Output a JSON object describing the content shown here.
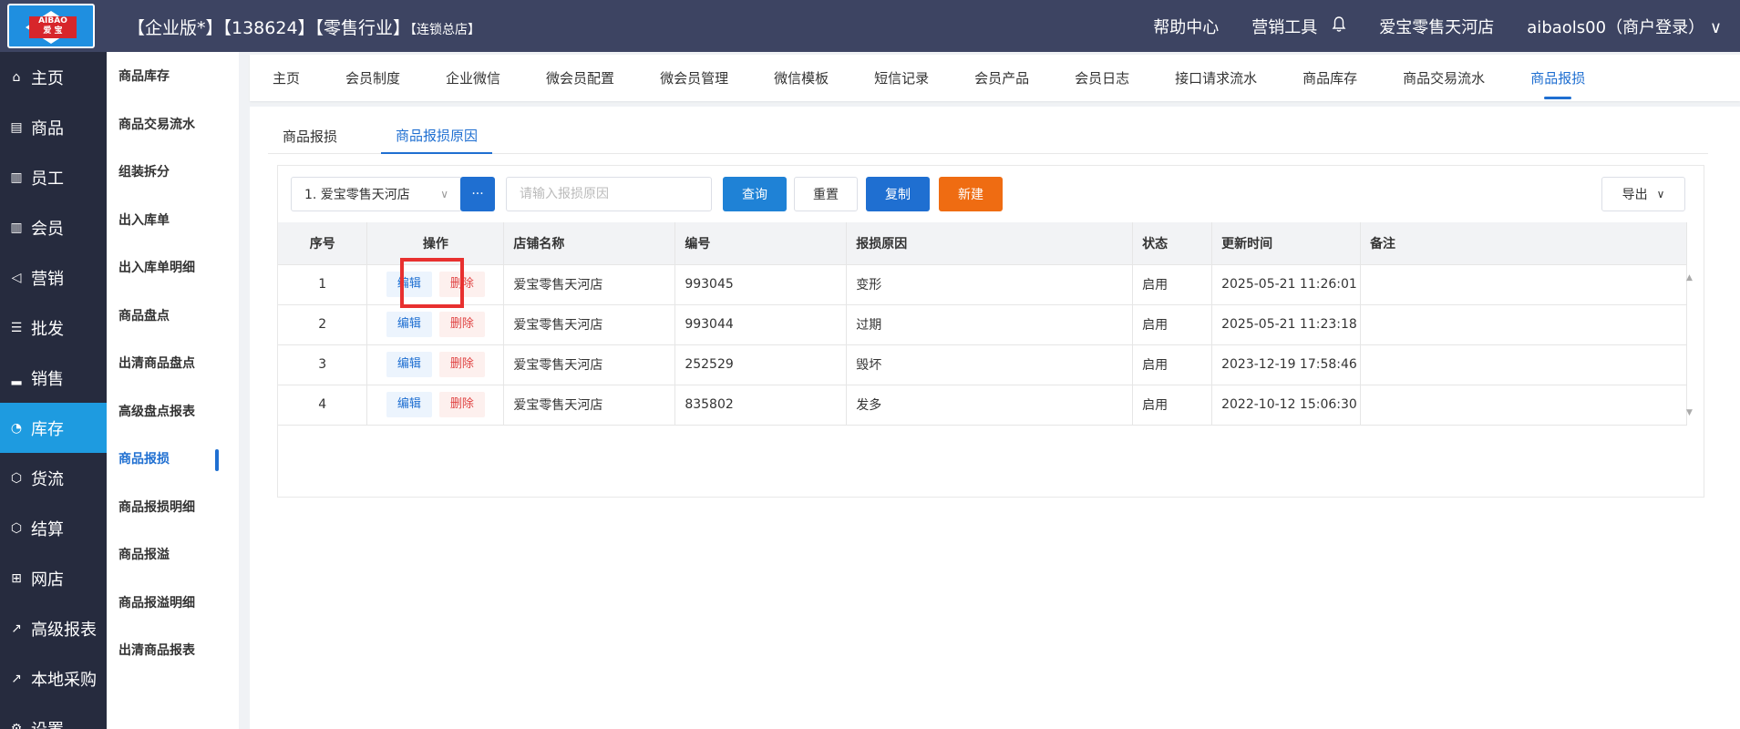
{
  "header": {
    "logo_text_top": "AIBAO",
    "logo_text_bottom": "爱 宝",
    "title": "【企业版*】【138624】【零售行业】",
    "title_suffix": "【连锁总店】",
    "help": "帮助中心",
    "marketing_tools": "营销工具",
    "store": "爱宝零售天河店",
    "user": "aibaols00（商户登录）",
    "user_chevron": "∨"
  },
  "leftnav": {
    "items": [
      {
        "label": "主页",
        "icon": "home-icon"
      },
      {
        "label": "商品",
        "icon": "goods-icon"
      },
      {
        "label": "员工",
        "icon": "staff-icon"
      },
      {
        "label": "会员",
        "icon": "member-icon"
      },
      {
        "label": "营销",
        "icon": "megaphone-icon"
      },
      {
        "label": "批发",
        "icon": "wholesale-icon"
      },
      {
        "label": "销售",
        "icon": "bar-chart-icon"
      },
      {
        "label": "库存",
        "icon": "pie-chart-icon"
      },
      {
        "label": "货流",
        "icon": "cube-icon"
      },
      {
        "label": "结算",
        "icon": "settle-icon"
      },
      {
        "label": "网店",
        "icon": "gift-icon"
      },
      {
        "label": "高级报表",
        "icon": "line-chart-icon"
      },
      {
        "label": "本地采购",
        "icon": "line-chart-icon"
      },
      {
        "label": "设置",
        "icon": "gear-icon"
      }
    ],
    "active": "库存"
  },
  "subnav": {
    "items": [
      "商品库存",
      "商品交易流水",
      "组装拆分",
      "出入库单",
      "出入库单明细",
      "商品盘点",
      "出清商品盘点",
      "高级盘点报表",
      "商品报损",
      "商品报损明细",
      "商品报溢",
      "商品报溢明细",
      "出清商品报表"
    ],
    "active": "商品报损"
  },
  "tabs": {
    "items": [
      "主页",
      "会员制度",
      "企业微信",
      "微会员配置",
      "微会员管理",
      "微信模板",
      "短信记录",
      "会员产品",
      "会员日志",
      "接口请求流水",
      "商品库存",
      "商品交易流水",
      "商品报损"
    ],
    "active": "商品报损"
  },
  "subtabs": {
    "items": [
      "商品报损",
      "商品报损原因"
    ],
    "active": "商品报损原因"
  },
  "filters": {
    "store_select": "1. 爱宝零售天河店",
    "more_label": "···",
    "reason_placeholder": "请输入报损原因",
    "query": "查询",
    "reset": "重置",
    "copy": "复制",
    "new": "新建",
    "export": "导出"
  },
  "table": {
    "headers": [
      "序号",
      "操作",
      "店铺名称",
      "编号",
      "报损原因",
      "状态",
      "更新时间",
      "备注"
    ],
    "edit_label": "编辑",
    "delete_label": "删除",
    "rows": [
      {
        "seq": "1",
        "store": "爱宝零售天河店",
        "code": "993045",
        "reason": "变形",
        "status": "启用",
        "updated": "2025-05-21 11:26:01",
        "note": ""
      },
      {
        "seq": "2",
        "store": "爱宝零售天河店",
        "code": "993044",
        "reason": "过期",
        "status": "启用",
        "updated": "2025-05-21 11:23:18",
        "note": ""
      },
      {
        "seq": "3",
        "store": "爱宝零售天河店",
        "code": "252529",
        "reason": "毁坏",
        "status": "启用",
        "updated": "2023-12-19 17:58:46",
        "note": ""
      },
      {
        "seq": "4",
        "store": "爱宝零售天河店",
        "code": "835802",
        "reason": "发多",
        "status": "启用",
        "updated": "2022-10-12 15:06:30",
        "note": ""
      }
    ]
  },
  "colors": {
    "topbar": "#3d4462",
    "leftnav": "#262b3e",
    "active_nav": "#1e9be0",
    "primary": "#1f6fd1",
    "new_button": "#ef6c12",
    "highlight": "#e8302f"
  }
}
